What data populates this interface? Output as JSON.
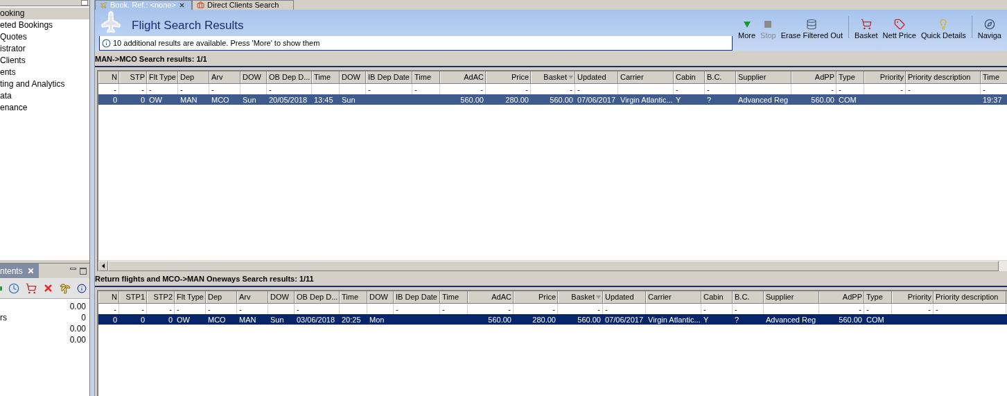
{
  "sidebar": {
    "items": [
      {
        "label": "ooking",
        "selected": true
      },
      {
        "label": "eted Bookings",
        "selected": false
      },
      {
        "label": "Quotes",
        "selected": false
      },
      {
        "label": "istrator",
        "selected": false
      },
      {
        "label": "Clients",
        "selected": false
      },
      {
        "label": "ents",
        "selected": false
      },
      {
        "label": "ting and Analytics",
        "selected": false
      },
      {
        "label": "ata",
        "selected": false
      },
      {
        "label": "enance",
        "selected": false
      }
    ]
  },
  "contents_panel": {
    "tab": "ntents",
    "rows": [
      {
        "kind": "value",
        "value": "0.00"
      },
      {
        "kind": "labelled",
        "label": "rs",
        "value": "0"
      },
      {
        "kind": "value",
        "value": "0.00"
      },
      {
        "kind": "value",
        "value": "0.00"
      }
    ]
  },
  "tabs": [
    {
      "label": "Book. Ref.: <none>",
      "selected": true
    },
    {
      "label": "Direct Clients Search",
      "selected": false
    }
  ],
  "header": {
    "title": "Flight Search Results",
    "info": "10 additional results are available. Press 'More' to show them"
  },
  "toolbar": [
    {
      "kind": "more",
      "label": "More",
      "disabled": false
    },
    {
      "kind": "stop",
      "label": "Stop",
      "disabled": true
    },
    {
      "kind": "erase",
      "label": "Erase Filtered Out",
      "disabled": false
    },
    {
      "kind": "separator"
    },
    {
      "kind": "basket",
      "label": "Basket",
      "disabled": false
    },
    {
      "kind": "nett",
      "label": "Nett Price",
      "disabled": false
    },
    {
      "kind": "details",
      "label": "Quick Details",
      "disabled": false
    },
    {
      "kind": "separator"
    },
    {
      "kind": "navigate",
      "label": "Naviga",
      "disabled": false
    }
  ],
  "results": [
    {
      "title": "MAN->MCO Search results: 1/1",
      "focused": false,
      "columns": [
        {
          "label": "N",
          "numeric": true
        },
        {
          "label": "STP",
          "numeric": true
        },
        {
          "label": "Flt Type",
          "numeric": false
        },
        {
          "label": "Dep",
          "numeric": false
        },
        {
          "label": "Arv",
          "numeric": false
        },
        {
          "label": "DOW",
          "numeric": false
        },
        {
          "label": "OB Dep D...",
          "numeric": false
        },
        {
          "label": "Time",
          "numeric": false
        },
        {
          "label": "DOW",
          "numeric": false
        },
        {
          "label": "IB Dep Date",
          "numeric": false
        },
        {
          "label": "Time",
          "numeric": false
        },
        {
          "label": "AdAC",
          "numeric": true
        },
        {
          "label": "Price",
          "numeric": true
        },
        {
          "label": "Basket",
          "numeric": true,
          "sorted": true
        },
        {
          "label": "Updated",
          "numeric": false
        },
        {
          "label": "Carrier",
          "numeric": false
        },
        {
          "label": "Cabin",
          "numeric": false
        },
        {
          "label": "B.C.",
          "numeric": false
        },
        {
          "label": "Supplier",
          "numeric": false
        },
        {
          "label": "AdPP",
          "numeric": true
        },
        {
          "label": "Type",
          "numeric": false
        },
        {
          "label": "Priority",
          "numeric": true
        },
        {
          "label": "Priority description",
          "numeric": false
        },
        {
          "label": "Time",
          "numeric": false
        }
      ],
      "filter": [
        {
          "kind": "text",
          "text": "-"
        },
        {
          "kind": "text",
          "text": "-"
        },
        {
          "kind": "text",
          "text": "-"
        },
        {
          "kind": "text",
          "text": "-"
        },
        {
          "kind": "text",
          "text": "-"
        },
        {
          "kind": "empty"
        },
        {
          "kind": "text",
          "text": "-"
        },
        {
          "kind": "empty"
        },
        {
          "kind": "empty"
        },
        {
          "kind": "text",
          "text": "-"
        },
        {
          "kind": "text",
          "text": "-"
        },
        {
          "kind": "text",
          "text": "-"
        },
        {
          "kind": "text",
          "text": "-"
        },
        {
          "kind": "text",
          "text": "-"
        },
        {
          "kind": "text",
          "text": "-"
        },
        {
          "kind": "empty"
        },
        {
          "kind": "text",
          "text": "-"
        },
        {
          "kind": "text",
          "text": "-"
        },
        {
          "kind": "empty"
        },
        {
          "kind": "text",
          "text": "-"
        },
        {
          "kind": "text",
          "text": "-"
        },
        {
          "kind": "text",
          "text": "-"
        },
        {
          "kind": "text",
          "text": "-"
        },
        {
          "kind": "text",
          "text": "-"
        }
      ],
      "rows": [
        {
          "selected": true,
          "cells": [
            {
              "kind": "text",
              "text": "0"
            },
            {
              "kind": "text",
              "text": "0"
            },
            {
              "kind": "text",
              "text": "OW"
            },
            {
              "kind": "text",
              "text": "MAN"
            },
            {
              "kind": "text",
              "text": "MCO"
            },
            {
              "kind": "text",
              "text": "Sun"
            },
            {
              "kind": "text",
              "text": "20/05/2018"
            },
            {
              "kind": "text",
              "text": "13:45"
            },
            {
              "kind": "text",
              "text": "Sun"
            },
            {
              "kind": "empty"
            },
            {
              "kind": "empty"
            },
            {
              "kind": "text",
              "text": "560.00"
            },
            {
              "kind": "text",
              "text": "280.00"
            },
            {
              "kind": "text",
              "text": "560.00"
            },
            {
              "kind": "text",
              "text": "07/06/2017"
            },
            {
              "kind": "text",
              "text": "Virgin Atlantic..."
            },
            {
              "kind": "text",
              "text": "Y"
            },
            {
              "kind": "text",
              "text": "?"
            },
            {
              "kind": "text",
              "text": "Advanced Reg"
            },
            {
              "kind": "text",
              "text": "560.00"
            },
            {
              "kind": "text",
              "text": "COM"
            },
            {
              "kind": "empty"
            },
            {
              "kind": "empty"
            },
            {
              "kind": "text",
              "text": "19:37"
            }
          ]
        }
      ]
    },
    {
      "title": "Return flights and MCO->MAN Oneways Search results: 1/11",
      "focused": true,
      "columns": [
        {
          "label": "N",
          "numeric": true
        },
        {
          "label": "STP1",
          "numeric": true
        },
        {
          "label": "STP2",
          "numeric": true
        },
        {
          "label": "Flt Type",
          "numeric": false
        },
        {
          "label": "Dep",
          "numeric": false
        },
        {
          "label": "Arv",
          "numeric": false
        },
        {
          "label": "DOW",
          "numeric": false
        },
        {
          "label": "OB Dep D...",
          "numeric": false
        },
        {
          "label": "Time",
          "numeric": false
        },
        {
          "label": "DOW",
          "numeric": false
        },
        {
          "label": "IB Dep Date",
          "numeric": false
        },
        {
          "label": "Time",
          "numeric": false
        },
        {
          "label": "AdAC",
          "numeric": true
        },
        {
          "label": "Price",
          "numeric": true
        },
        {
          "label": "Basket",
          "numeric": true,
          "sorted": true
        },
        {
          "label": "Updated",
          "numeric": false
        },
        {
          "label": "Carrier",
          "numeric": false
        },
        {
          "label": "Cabin",
          "numeric": false
        },
        {
          "label": "B.C.",
          "numeric": false
        },
        {
          "label": "Supplier",
          "numeric": false
        },
        {
          "label": "AdPP",
          "numeric": true
        },
        {
          "label": "Type",
          "numeric": false
        },
        {
          "label": "Priority",
          "numeric": true
        },
        {
          "label": "Priority description",
          "numeric": false
        }
      ],
      "filter": [
        {
          "kind": "text",
          "text": "-"
        },
        {
          "kind": "text",
          "text": "-"
        },
        {
          "kind": "text",
          "text": "-"
        },
        {
          "kind": "text",
          "text": "-"
        },
        {
          "kind": "text",
          "text": "-"
        },
        {
          "kind": "text",
          "text": "-"
        },
        {
          "kind": "empty"
        },
        {
          "kind": "text",
          "text": "-"
        },
        {
          "kind": "empty"
        },
        {
          "kind": "empty"
        },
        {
          "kind": "text",
          "text": "-"
        },
        {
          "kind": "text",
          "text": "-"
        },
        {
          "kind": "text",
          "text": "-"
        },
        {
          "kind": "text",
          "text": "-"
        },
        {
          "kind": "text",
          "text": "-"
        },
        {
          "kind": "text",
          "text": "-"
        },
        {
          "kind": "empty"
        },
        {
          "kind": "text",
          "text": "-"
        },
        {
          "kind": "text",
          "text": "-"
        },
        {
          "kind": "empty"
        },
        {
          "kind": "text",
          "text": "-"
        },
        {
          "kind": "text",
          "text": "-"
        },
        {
          "kind": "text",
          "text": "-"
        },
        {
          "kind": "text",
          "text": "-"
        }
      ],
      "rows": [
        {
          "selected": true,
          "cells": [
            {
              "kind": "text",
              "text": "0"
            },
            {
              "kind": "text",
              "text": "0"
            },
            {
              "kind": "text",
              "text": "0"
            },
            {
              "kind": "text",
              "text": "OW"
            },
            {
              "kind": "text",
              "text": "MCO"
            },
            {
              "kind": "text",
              "text": "MAN"
            },
            {
              "kind": "text",
              "text": "Sun"
            },
            {
              "kind": "text",
              "text": "03/06/2018"
            },
            {
              "kind": "text",
              "text": "20:25"
            },
            {
              "kind": "text",
              "text": "Mon"
            },
            {
              "kind": "empty"
            },
            {
              "kind": "empty"
            },
            {
              "kind": "text",
              "text": "560.00"
            },
            {
              "kind": "text",
              "text": "280.00"
            },
            {
              "kind": "text",
              "text": "560.00"
            },
            {
              "kind": "text",
              "text": "07/06/2017"
            },
            {
              "kind": "text",
              "text": "Virgin Atlantic..."
            },
            {
              "kind": "text",
              "text": "Y"
            },
            {
              "kind": "text",
              "text": "?"
            },
            {
              "kind": "text",
              "text": "Advanced Reg"
            },
            {
              "kind": "text",
              "text": "560.00"
            },
            {
              "kind": "text",
              "text": "COM"
            },
            {
              "kind": "empty"
            },
            {
              "kind": "empty"
            }
          ]
        }
      ]
    }
  ]
}
